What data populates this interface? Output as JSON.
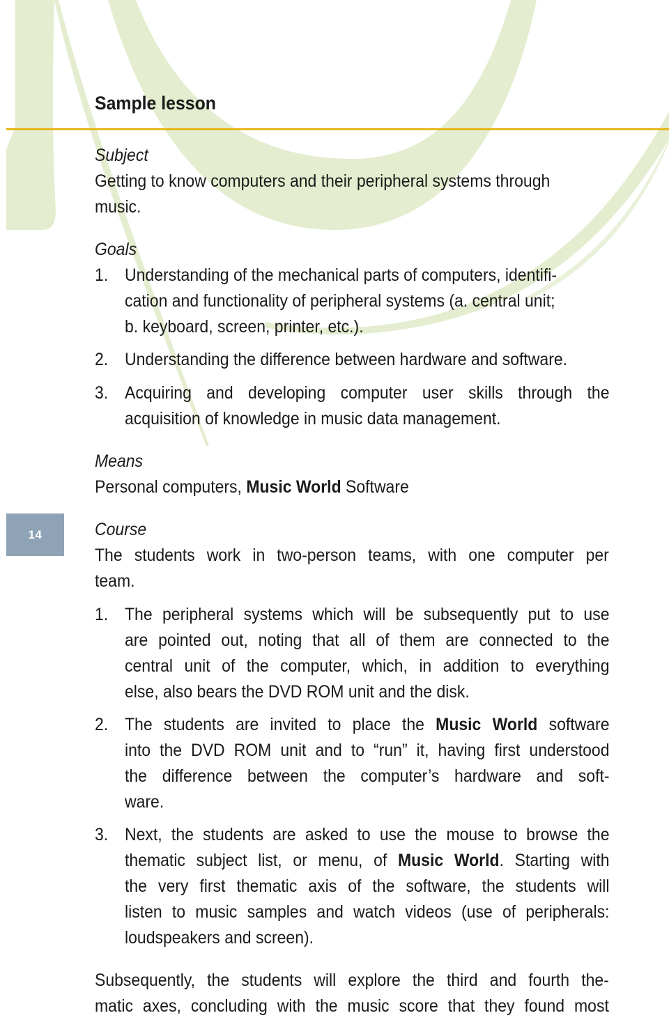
{
  "page": {
    "title": "Sample lesson",
    "page_number": "14",
    "colors": {
      "accent_rule": "#e6b820",
      "badge": "#8ea3b5",
      "swoosh": "#e4edcf",
      "text": "#1a1a1a"
    }
  },
  "subject": {
    "heading": "Subject",
    "lines": [
      "Getting to know computers and their peripheral systems through",
      "music."
    ]
  },
  "goals": {
    "heading": "Goals",
    "items": [
      {
        "num": "1.",
        "lines": [
          "Understanding of the mechanical parts of computers, identifi-",
          "cation and functionality of peripheral systems (a. central unit;",
          "b. keyboard, screen, printer, etc.)."
        ]
      },
      {
        "num": "2.",
        "lines": [
          "Understanding the difference between hardware and software."
        ]
      },
      {
        "num": "3.",
        "lines": [
          "Acquiring and developing computer user skills through the",
          "acquisition of knowledge in music data management."
        ]
      }
    ]
  },
  "means": {
    "heading": "Means",
    "pre": "Personal computers, ",
    "bold": "Music World",
    "post": " Software"
  },
  "course": {
    "heading": "Course",
    "lines": [
      "The students work in two-person teams, with one computer per",
      "team."
    ],
    "items": [
      {
        "num": "1.",
        "lines": [
          "The peripheral systems which will be subsequently put to use",
          "are pointed out, noting that all of them are connected to the",
          "central unit of the computer, which, in addition to everything",
          "else, also bears the DVD ROM unit and the disk."
        ]
      },
      {
        "num": "2.",
        "line1_pre": "The students are invited to place the ",
        "line1_bold": "Music World",
        "line1_post": " software",
        "lines": [
          "into the DVD ROM unit and to “run” it, having first understood",
          "the difference between the computer’s hardware and soft-",
          "ware."
        ]
      },
      {
        "num": "3.",
        "line1": "Next, the students are asked to use the mouse to browse the",
        "line2_pre": "thematic subject list, or menu, of ",
        "line2_bold": "Music World",
        "line2_post": ". Starting with",
        "lines": [
          "the very first thematic axis of the software, the students will",
          "listen to music samples and watch videos (use of peripherals:",
          "loudspeakers and screen)."
        ]
      }
    ],
    "closing": [
      "Subsequently, the students will explore the third and fourth the-",
      "matic axes, concluding with the music score that they found most"
    ]
  }
}
